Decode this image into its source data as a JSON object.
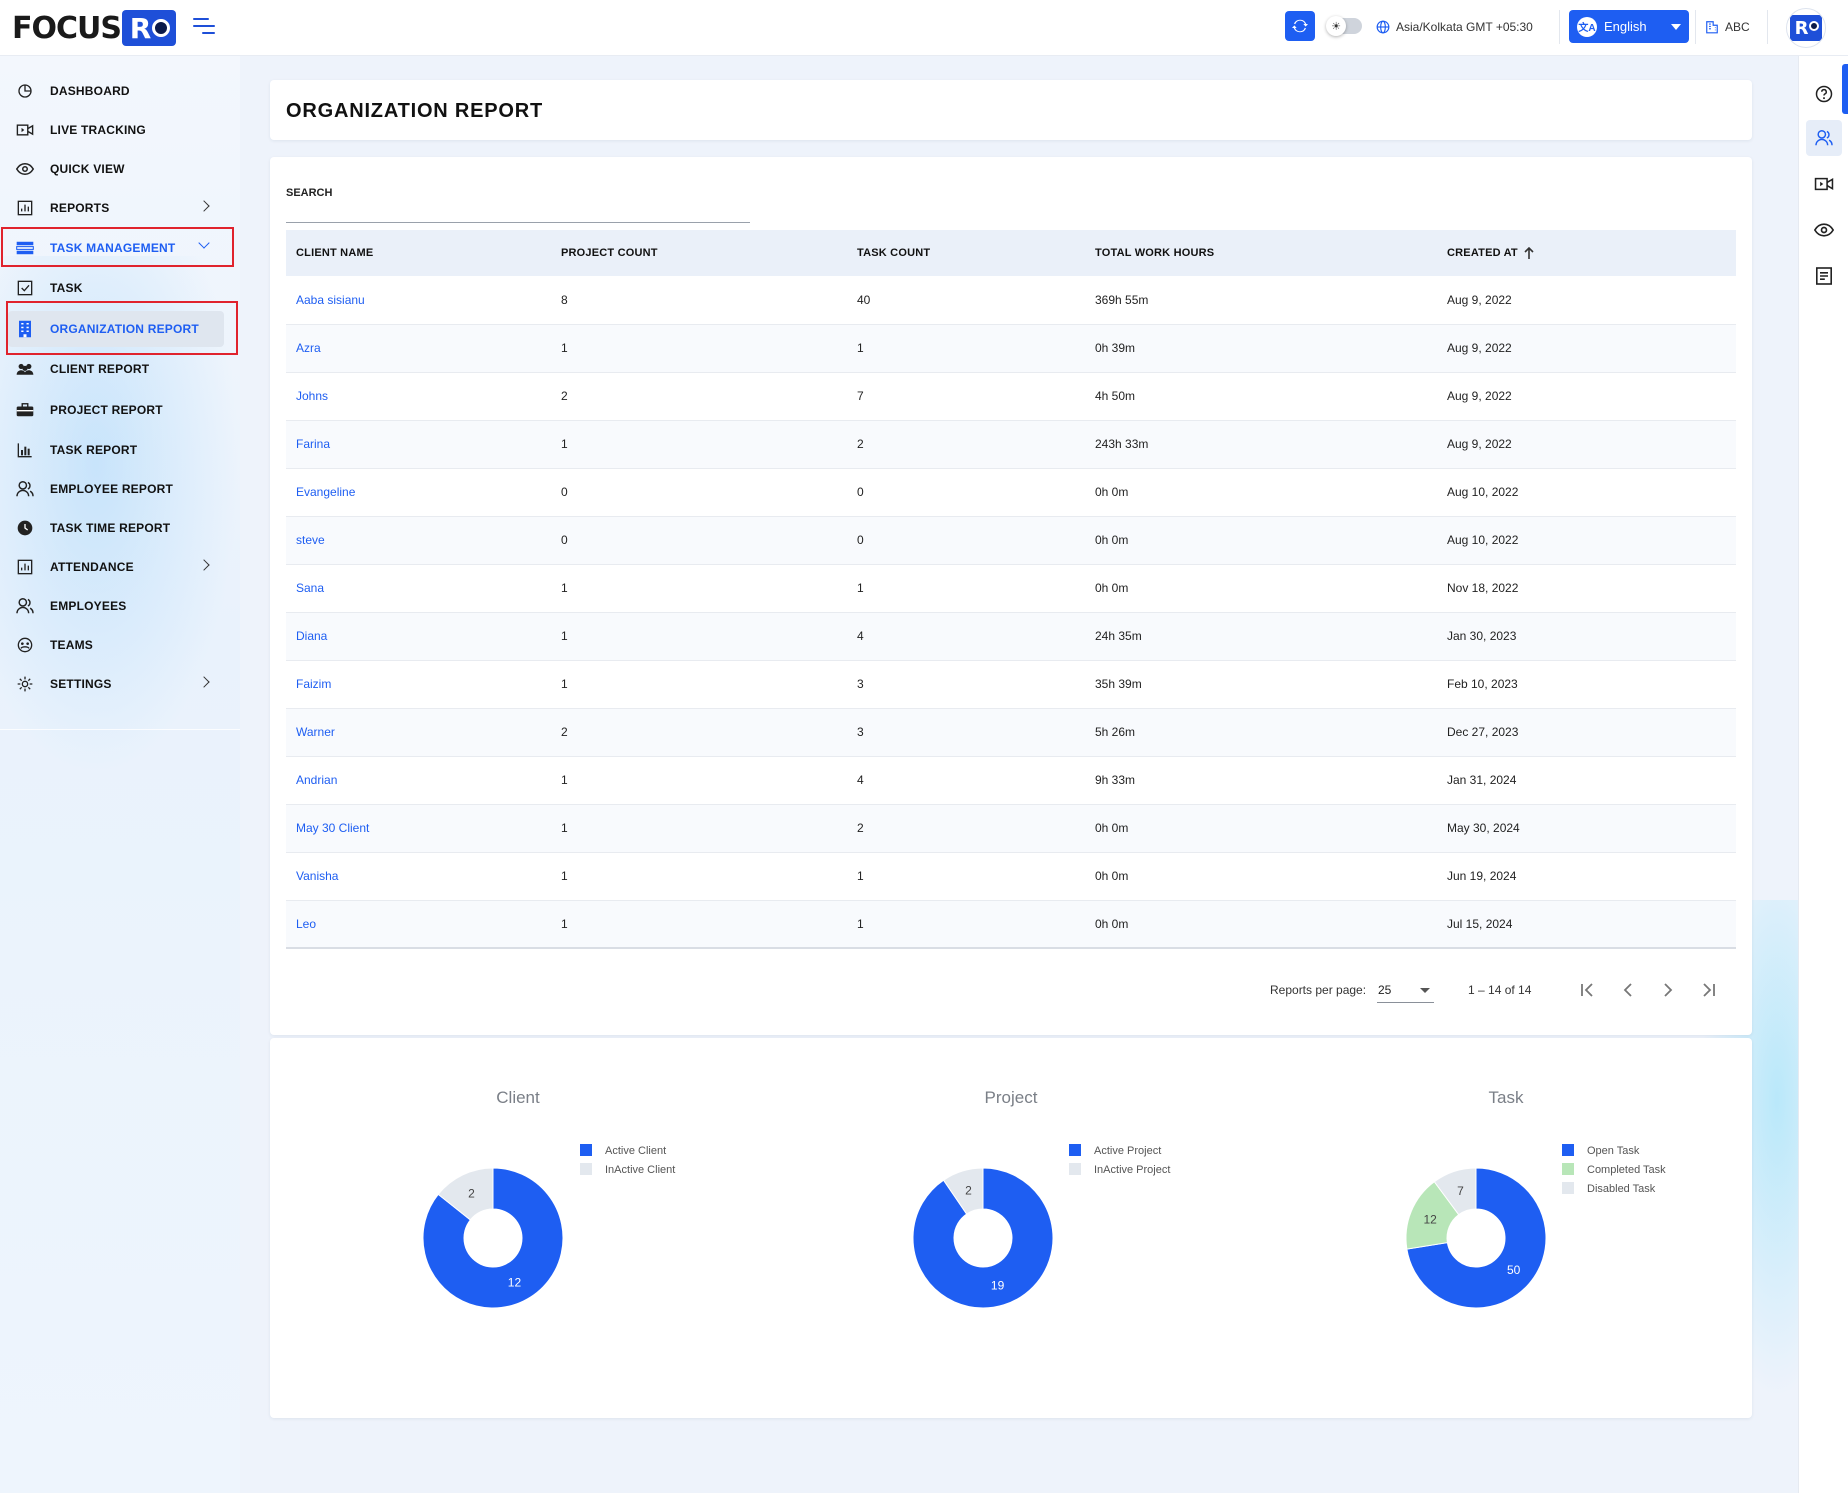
{
  "app": {
    "logo_text": "FOCUS",
    "logo_badge": "R"
  },
  "topbar": {
    "timezone": "Asia/Kolkata GMT +05:30",
    "language": "English",
    "org": "ABC"
  },
  "sidebar": {
    "items": [
      {
        "label": "DASHBOARD",
        "icon": "dashboard-icon"
      },
      {
        "label": "LIVE TRACKING",
        "icon": "video-icon"
      },
      {
        "label": "QUICK VIEW",
        "icon": "eye-icon"
      },
      {
        "label": "REPORTS",
        "icon": "report-chart-icon"
      },
      {
        "label": "TASK MANAGEMENT",
        "icon": "task-management-icon"
      },
      {
        "label": "TASK",
        "icon": "checkbox-icon"
      },
      {
        "label": "ORGANIZATION REPORT",
        "icon": "building-icon"
      },
      {
        "label": "CLIENT REPORT",
        "icon": "group-icon"
      },
      {
        "label": "PROJECT REPORT",
        "icon": "briefcase-icon"
      },
      {
        "label": "TASK REPORT",
        "icon": "bar-report-icon"
      },
      {
        "label": "EMPLOYEE REPORT",
        "icon": "user-icon"
      },
      {
        "label": "TASK TIME REPORT",
        "icon": "clock-icon"
      },
      {
        "label": "ATTENDANCE",
        "icon": "attendance-icon"
      },
      {
        "label": "EMPLOYEES",
        "icon": "users-icon"
      },
      {
        "label": "TEAMS",
        "icon": "teams-icon"
      },
      {
        "label": "SETTINGS",
        "icon": "gear-icon"
      }
    ]
  },
  "page": {
    "title": "ORGANIZATION REPORT",
    "search_label": "SEARCH",
    "search_value": ""
  },
  "table": {
    "headers": [
      "CLIENT NAME",
      "PROJECT COUNT",
      "TASK COUNT",
      "TOTAL WORK HOURS",
      "CREATED AT"
    ],
    "rows": [
      [
        "Aaba sisianu",
        "8",
        "40",
        "369h 55m",
        "Aug 9, 2022"
      ],
      [
        "Azra",
        "1",
        "1",
        "0h 39m",
        "Aug 9, 2022"
      ],
      [
        "Johns",
        "2",
        "7",
        "4h 50m",
        "Aug 9, 2022"
      ],
      [
        "Farina",
        "1",
        "2",
        "243h 33m",
        "Aug 9, 2022"
      ],
      [
        "Evangeline",
        "0",
        "0",
        "0h 0m",
        "Aug 10, 2022"
      ],
      [
        "steve",
        "0",
        "0",
        "0h 0m",
        "Aug 10, 2022"
      ],
      [
        "Sana",
        "1",
        "1",
        "0h 0m",
        "Nov 18, 2022"
      ],
      [
        "Diana",
        "1",
        "4",
        "24h 35m",
        "Jan 30, 2023"
      ],
      [
        "Faizim",
        "1",
        "3",
        "35h 39m",
        "Feb 10, 2023"
      ],
      [
        "Warner",
        "2",
        "3",
        "5h 26m",
        "Dec 27, 2023"
      ],
      [
        "Andrian",
        "1",
        "4",
        "9h 33m",
        "Jan 31, 2024"
      ],
      [
        "May 30 Client",
        "1",
        "2",
        "0h 0m",
        "May 30, 2024"
      ],
      [
        "Vanisha",
        "1",
        "1",
        "0h 0m",
        "Jun 19, 2024"
      ],
      [
        "Leo",
        "1",
        "1",
        "0h 0m",
        "Jul 15, 2024"
      ]
    ]
  },
  "pagination": {
    "per_page_label": "Reports per page:",
    "per_page": "25",
    "range": "1 – 14 of 14"
  },
  "colors": {
    "primary": "#1e5ef2",
    "inactive": "#e3e8ee",
    "completed": "#b8e6b8"
  },
  "chart_data": [
    {
      "type": "pie",
      "title": "Client",
      "categories": [
        "Active Client",
        "InActive Client"
      ],
      "values": [
        12,
        2
      ],
      "colors": [
        "#1e5ef2",
        "#e3e8ee"
      ],
      "legend": "right"
    },
    {
      "type": "pie",
      "title": "Project",
      "categories": [
        "Active Project",
        "InActive Project"
      ],
      "values": [
        19,
        2
      ],
      "colors": [
        "#1e5ef2",
        "#e3e8ee"
      ],
      "legend": "right"
    },
    {
      "type": "pie",
      "title": "Task",
      "categories": [
        "Open Task",
        "Completed Task",
        "Disabled Task"
      ],
      "values": [
        50,
        12,
        7
      ],
      "colors": [
        "#1e5ef2",
        "#b8e6b8",
        "#e3e8ee"
      ],
      "legend": "right"
    }
  ]
}
